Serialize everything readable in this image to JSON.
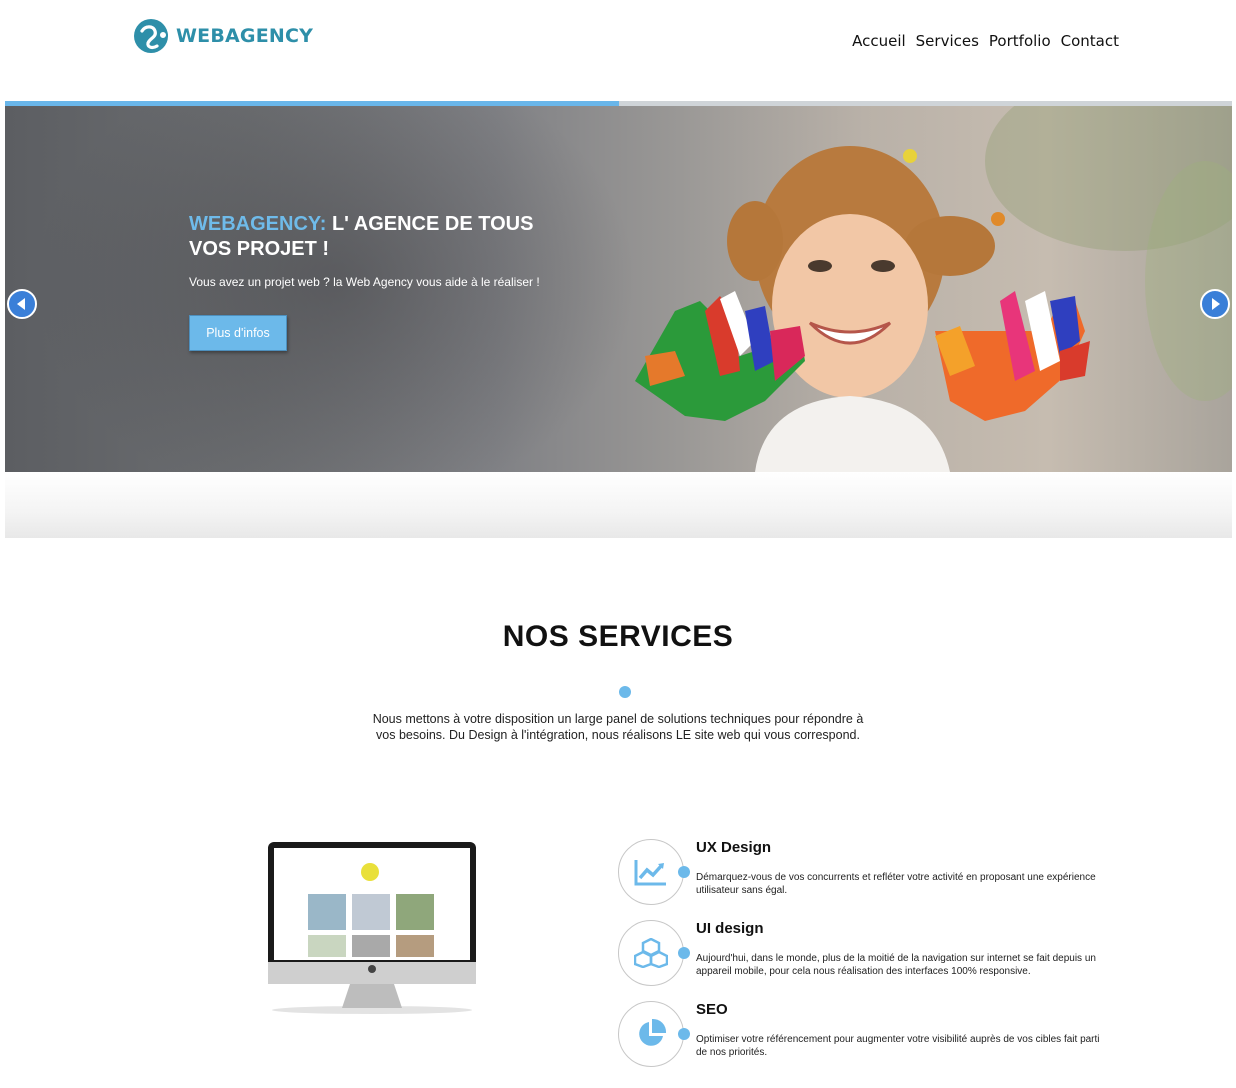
{
  "header": {
    "brand": "WEBAGENCY",
    "nav": [
      "Accueil",
      "Services",
      "Portfolio",
      "Contact"
    ]
  },
  "hero": {
    "title_brand": "WEBAGENCY:",
    "title_rest": " L' AGENCE DE TOUS VOS PROJET !",
    "subtitle": "Vous avez un projet web ? la Web Agency vous aide à le réaliser !",
    "button_label": "Plus d'infos",
    "progress_fraction": 0.5
  },
  "services": {
    "title": "NOS SERVICES",
    "description": "Nous mettons à votre disposition un large panel de solutions techniques pour répondre à vos besoins. Du Design à l'intégration, nous réalisons LE site web qui vous correspond.",
    "items": [
      {
        "title": "UX Design",
        "text": "Démarquez-vous de vos concurrents et refléter votre activité en proposant une expérience utilisateur sans égal.",
        "icon": "chart-line-icon"
      },
      {
        "title": "UI design",
        "text": "Aujourd'hui, dans le monde, plus de la moitié de la navigation sur internet se fait depuis un appareil mobile, pour cela nous réalisation des interfaces 100% responsive.",
        "icon": "cubes-icon"
      },
      {
        "title": "SEO",
        "text": "Optimiser votre référencement pour augmenter votre visibilité auprès de vos cibles fait parti de nos priorités.",
        "icon": "pie-chart-icon"
      }
    ]
  },
  "colors": {
    "accent": "#6cb9ea",
    "brand": "#2e8fa9",
    "arrow": "#3a7fd8"
  }
}
